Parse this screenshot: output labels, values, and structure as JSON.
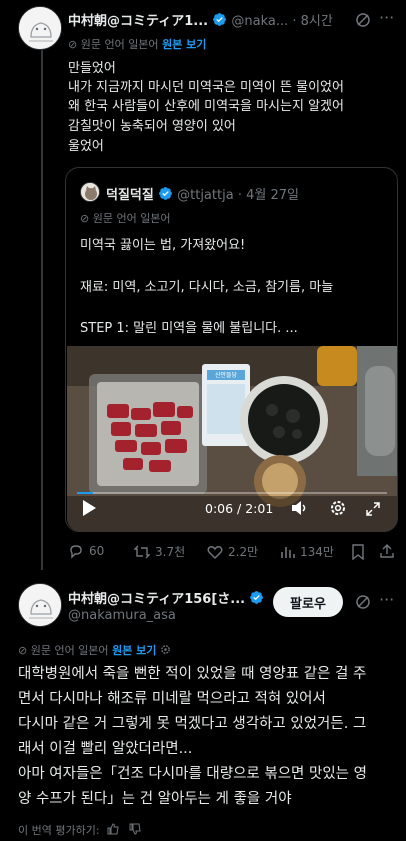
{
  "post1": {
    "author_name": "中村朝@コミティア1...",
    "handle": "@naka...",
    "time": "· 8시간",
    "translate_note": "원문 언어 일본어",
    "show_original": "원본 보기",
    "lines": [
      "만들었어",
      "내가 지금까지 마시던 미역국은 미역이 뜬 물이었어",
      "왜 한국 사람들이 산후에 미역국을 마시는지 알겠어",
      "감칠맛이 농축되어 영양이 있어",
      "울었어"
    ]
  },
  "quote": {
    "author_name": "덕질덕질",
    "handle": "@ttjattja",
    "date": "· 4월 27일",
    "translate_note": "원문 언어 일본어",
    "lines": [
      "미역국 끓이는 법, 가져왔어요!",
      "재료: 미역, 소고기, 다시다, 소금, 참기름, 마늘",
      "STEP 1: 말린 미역을 물에 불립니다. ..."
    ],
    "video": {
      "time": "0:06 / 2:01",
      "progress": 0.05,
      "package_label": "산안뜰당"
    }
  },
  "actions": {
    "replies": "60",
    "reposts": "3.7천",
    "likes": "2.2만",
    "views": "134만"
  },
  "post2": {
    "author_name": "中村朝@コミティア156[さ...",
    "handle": "@nakamura_asa",
    "follow_label": "팔로우",
    "translate_note": "원문 언어 일본어",
    "show_original": "원본 보기",
    "lines": [
      "대학병원에서 죽을 뻔한 적이 있었을 때 영양표 같은 걸 주",
      "면서 다시마나 해조류 미네랄 먹으라고 적혀 있어서",
      "다시마 같은 거 그렇게 못 먹겠다고 생각하고 있었거든. 그",
      "래서 이걸 빨리 알았더라면...",
      "아마 여자들은「건조 다시마를 대량으로 볶으면 맛있는 영",
      "양 수프가 된다」는 건 알아두는 게 좋을 거야"
    ],
    "rate_translation": "이 번역 평가하기:"
  },
  "colors": {
    "accent": "#1d9bf0",
    "muted": "#71767b",
    "background": "#000000"
  }
}
